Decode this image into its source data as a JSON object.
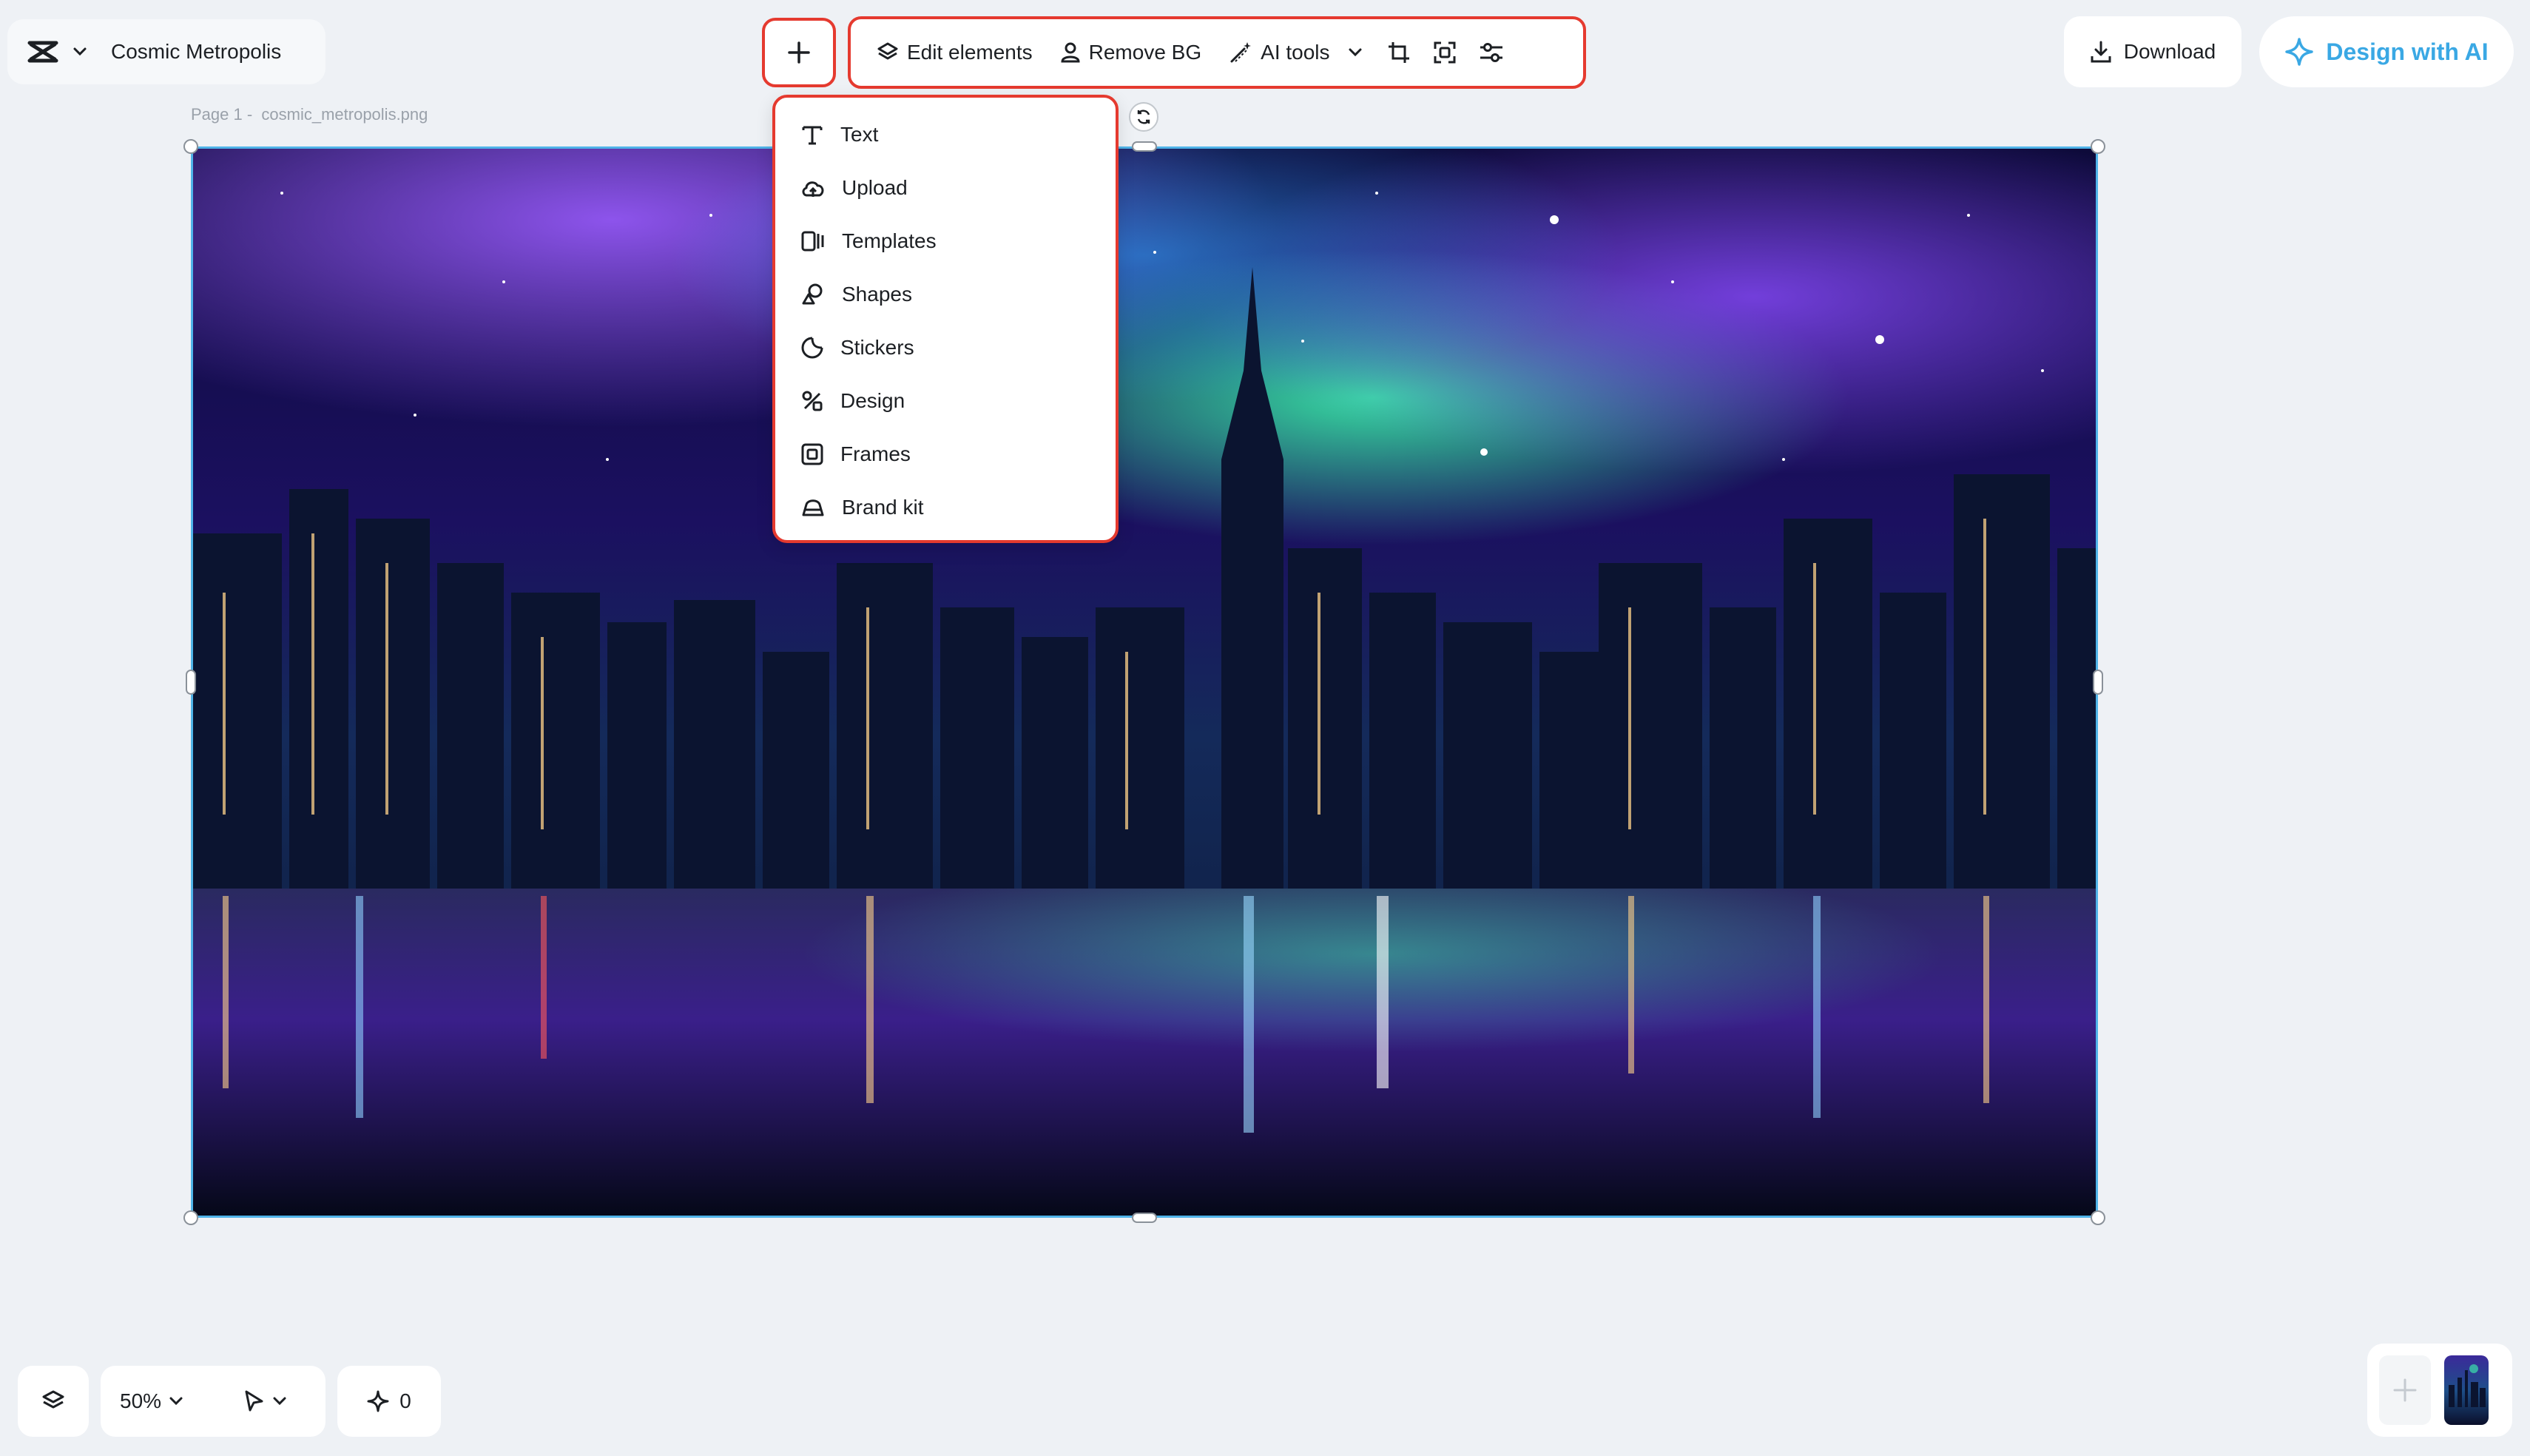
{
  "project": {
    "title": "Cosmic Metropolis",
    "logo_icon": "capcut-logo-icon"
  },
  "toolbar": {
    "add_icon": "plus-icon",
    "edit_elements": "Edit elements",
    "remove_bg": "Remove BG",
    "ai_tools": "AI tools"
  },
  "header_right": {
    "download": "Download",
    "design_with_ai": "Design with AI"
  },
  "page": {
    "label": "Page 1 -",
    "filename": "cosmic_metropolis.png"
  },
  "add_menu": {
    "items": [
      {
        "label": "Text",
        "icon": "text-icon"
      },
      {
        "label": "Upload",
        "icon": "cloud-upload-icon"
      },
      {
        "label": "Templates",
        "icon": "templates-icon"
      },
      {
        "label": "Shapes",
        "icon": "shapes-icon"
      },
      {
        "label": "Stickers",
        "icon": "sticker-icon"
      },
      {
        "label": "Design",
        "icon": "design-icon"
      },
      {
        "label": "Frames",
        "icon": "frames-icon"
      },
      {
        "label": "Brand kit",
        "icon": "brand-kit-icon"
      }
    ]
  },
  "bottom": {
    "zoom": "50%",
    "credits": "0"
  },
  "colors": {
    "highlight": "#e53a2f",
    "accent": "#3aa8e4",
    "selection": "#4fb3e8"
  }
}
